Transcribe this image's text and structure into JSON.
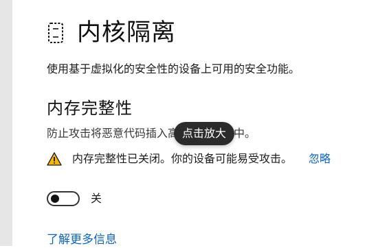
{
  "page": {
    "title": "内核隔离",
    "description": "使用基于虚拟化的安全性的设备上可用的安全功能。",
    "title_icon": "chip-icon"
  },
  "memory_integrity": {
    "title": "内存完整性",
    "description": "防止攻击将恶意代码插入高安全性进程中。",
    "warning_icon": "warning-icon",
    "warning_text": "内存完整性已关闭。你的设备可能易受攻击。",
    "ignore_link": "忽略",
    "toggle_state": "off",
    "toggle_label": "关"
  },
  "tooltip": {
    "text": "点击放大"
  },
  "footer": {
    "learn_more": "了解更多信息"
  },
  "colors": {
    "accent": "#0a63c9",
    "tooltip_bg": "#2b2b2b",
    "warning_fill": "#f5b700",
    "left_strip": "#e6e6e6"
  }
}
